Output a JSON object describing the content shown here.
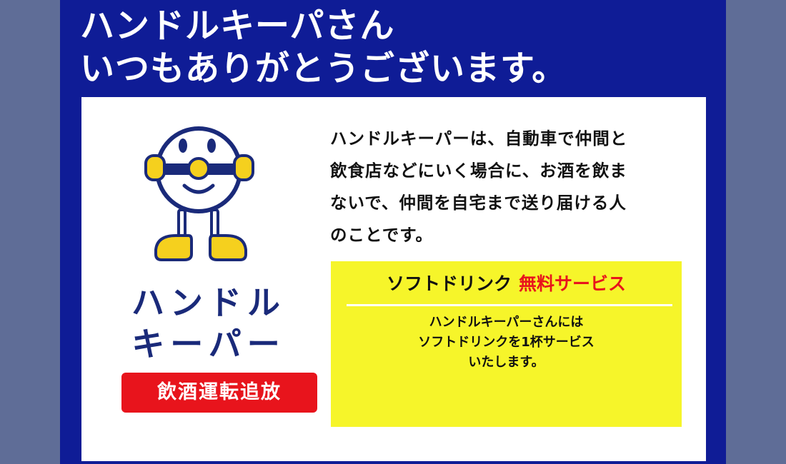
{
  "headline": {
    "line1": "ハンドルキーパさん",
    "line2": "いつもありがとうございます。"
  },
  "logo": {
    "line1": "ハンドル",
    "line2": "キーパー",
    "badge": "飲酒運転追放",
    "mascot_icon": "steering-wheel-mascot-icon"
  },
  "description": "ハンドルキーパーは、自動車で仲間と\n飲食店などにいく場合に、お酒を飲ま\nないで、仲間を自宅まで送り届ける人\nのことです。",
  "offer": {
    "title_black": "ソフトドリンク",
    "title_red": "無料サービス",
    "body": "ハンドルキーパーさんには\nソフトドリンクを1杯サービス\nいたします。"
  },
  "colors": {
    "page_background": "#5f6d97",
    "poster_blue": "#0f1c96",
    "logo_navy": "#1a2a7a",
    "accent_red": "#e8141c",
    "offer_yellow": "#f6f52a",
    "mascot_yellow": "#f5d01e"
  }
}
